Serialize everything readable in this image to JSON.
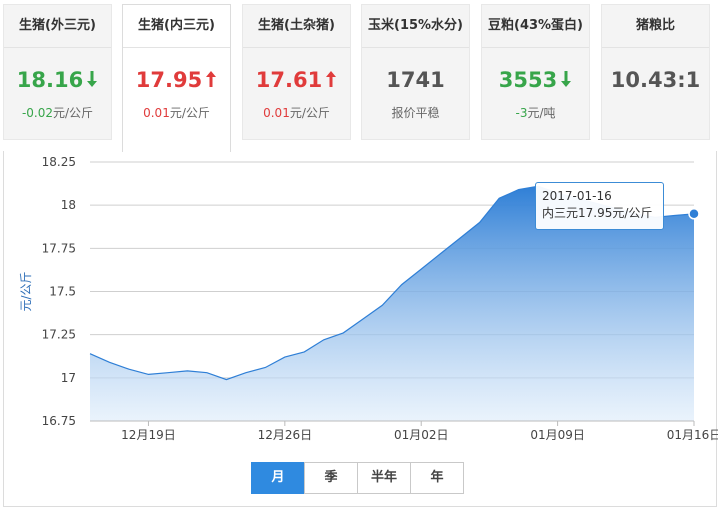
{
  "colors": {
    "up": "#e03b3b",
    "down": "#37a54a",
    "neutral": "#555555",
    "accent": "#2f8ae0"
  },
  "cards": [
    {
      "title": "生猪(外三元)",
      "price": "18.16",
      "change": "-0.02",
      "change_unit": "元/公斤",
      "trend": "down",
      "arrow_icon": "arrow-down-icon"
    },
    {
      "title": "生猪(内三元)",
      "price": "17.95",
      "change": "0.01",
      "change_unit": "元/公斤",
      "trend": "up",
      "arrow_icon": "arrow-up-icon",
      "active": true
    },
    {
      "title": "生猪(土杂猪)",
      "price": "17.61",
      "change": "0.01",
      "change_unit": "元/公斤",
      "trend": "up",
      "arrow_icon": "arrow-up-icon"
    },
    {
      "title": "玉米(15%水分)",
      "price": "1741",
      "change": "",
      "change_unit": "报价平稳",
      "trend": "flat"
    },
    {
      "title": "豆粕(43%蛋白)",
      "price": "3553",
      "change": "-3",
      "change_unit": "元/吨",
      "trend": "down",
      "arrow_icon": "arrow-down-icon"
    },
    {
      "title": "猪粮比",
      "price": "10.43:1",
      "change": "",
      "change_unit": "",
      "trend": "flat"
    }
  ],
  "tooltip": {
    "date": "2017-01-16",
    "text": "内三元17.95元/公斤"
  },
  "ranges": [
    {
      "label": "月",
      "active": true
    },
    {
      "label": "季",
      "active": false
    },
    {
      "label": "半年",
      "active": false
    },
    {
      "label": "年",
      "active": false
    }
  ],
  "chart_data": {
    "type": "area",
    "ylabel": "元/公斤",
    "ylim": [
      16.75,
      18.25
    ],
    "yticks": [
      "16.75",
      "17",
      "17.25",
      "17.5",
      "17.75",
      "18",
      "18.25"
    ],
    "xticks": [
      "12月19日",
      "12月26日",
      "01月02日",
      "01月09日",
      "01月16日"
    ],
    "grid": true,
    "series": [
      {
        "values": [
          {
            "x": "2016-12-16",
            "y": 17.14
          },
          {
            "x": "2016-12-17",
            "y": 17.09
          },
          {
            "x": "2016-12-18",
            "y": 17.05
          },
          {
            "x": "2016-12-19",
            "y": 17.02
          },
          {
            "x": "2016-12-20",
            "y": 17.03
          },
          {
            "x": "2016-12-21",
            "y": 17.04
          },
          {
            "x": "2016-12-22",
            "y": 17.03
          },
          {
            "x": "2016-12-23",
            "y": 16.99
          },
          {
            "x": "2016-12-24",
            "y": 17.03
          },
          {
            "x": "2016-12-25",
            "y": 17.06
          },
          {
            "x": "2016-12-26",
            "y": 17.12
          },
          {
            "x": "2016-12-27",
            "y": 17.15
          },
          {
            "x": "2016-12-28",
            "y": 17.22
          },
          {
            "x": "2016-12-29",
            "y": 17.26
          },
          {
            "x": "2016-12-30",
            "y": 17.34
          },
          {
            "x": "2016-12-31",
            "y": 17.42
          },
          {
            "x": "2017-01-01",
            "y": 17.54
          },
          {
            "x": "2017-01-02",
            "y": 17.63
          },
          {
            "x": "2017-01-03",
            "y": 17.72
          },
          {
            "x": "2017-01-04",
            "y": 17.81
          },
          {
            "x": "2017-01-05",
            "y": 17.9
          },
          {
            "x": "2017-01-06",
            "y": 18.04
          },
          {
            "x": "2017-01-07",
            "y": 18.09
          },
          {
            "x": "2017-01-08",
            "y": 18.11
          },
          {
            "x": "2017-01-09",
            "y": 18.07
          },
          {
            "x": "2017-01-10",
            "y": 18.04
          },
          {
            "x": "2017-01-11",
            "y": 18.01
          },
          {
            "x": "2017-01-12",
            "y": 17.98
          },
          {
            "x": "2017-01-13",
            "y": 17.95
          },
          {
            "x": "2017-01-14",
            "y": 17.93
          },
          {
            "x": "2017-01-15",
            "y": 17.94
          },
          {
            "x": "2017-01-16",
            "y": 17.95
          }
        ]
      }
    ]
  }
}
